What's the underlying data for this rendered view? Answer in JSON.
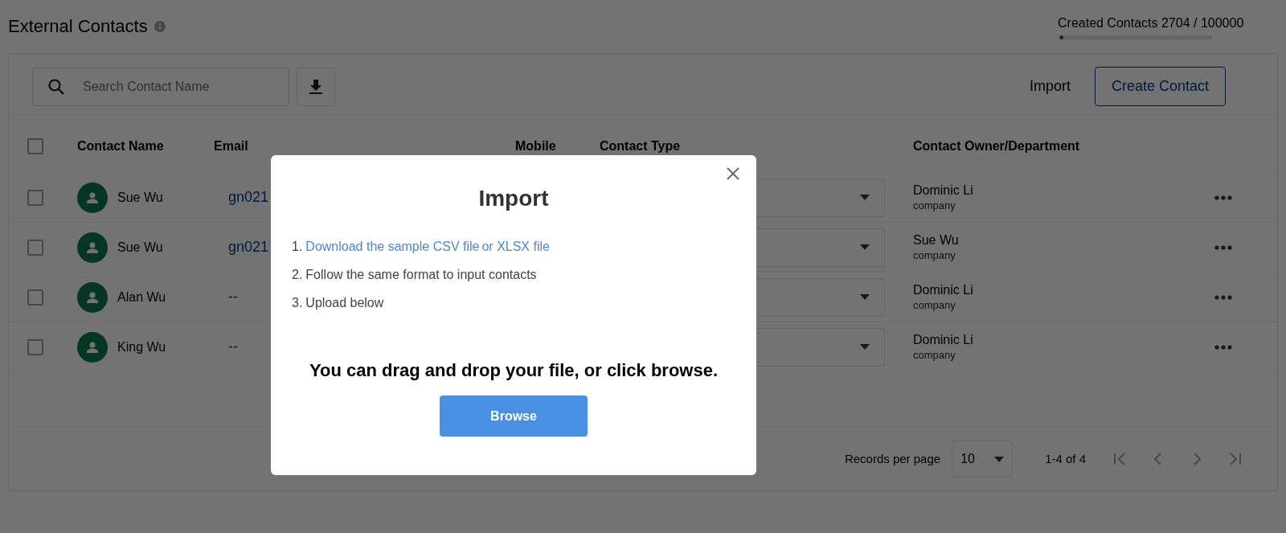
{
  "page": {
    "title": "External Contacts",
    "quota": {
      "label": "Created Contacts 2704 / 100000",
      "level": 0.027
    }
  },
  "toolbar": {
    "search": {
      "placeholder": "Search Contact Name"
    },
    "import_label": "Import",
    "create_label": "Create Contact"
  },
  "table": {
    "select_all": {
      "checked": false
    },
    "columns": [
      "Contact Name",
      "Email",
      "Mobile",
      "Contact Type",
      "Contact Owner/Department"
    ],
    "rows": [
      {
        "checked": false,
        "name": "Sue Wu",
        "email": "gn021",
        "owner": "Dominic Li",
        "department": "company"
      },
      {
        "checked": false,
        "name": "Sue Wu",
        "email": "gn021",
        "owner": "Sue Wu",
        "department": "company"
      },
      {
        "checked": false,
        "name": "Alan Wu",
        "email": "--",
        "owner": "Dominic Li",
        "department": "company"
      },
      {
        "checked": false,
        "name": "King Wu",
        "email": "--",
        "owner": "Dominic Li",
        "department": "company"
      }
    ]
  },
  "pagination": {
    "records_label": "Records per page",
    "per_page": "10",
    "range": "1-4 of 4"
  },
  "dialog": {
    "title": "Import",
    "steps": [
      {
        "number": "1.",
        "kind": "links",
        "links": [
          "Download the sample CSV file",
          "or XLSX file"
        ]
      },
      {
        "number": "2.",
        "kind": "text",
        "text": "Follow the same format to input contacts"
      },
      {
        "number": "3.",
        "kind": "text",
        "text": "Upload below"
      }
    ],
    "drop_hint": "You can drag and drop your file, or click browse.",
    "browse_label": "Browse"
  }
}
